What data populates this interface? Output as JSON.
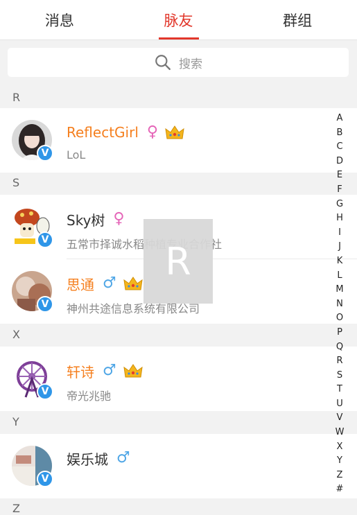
{
  "tabs": [
    {
      "label": "消息",
      "active": false
    },
    {
      "label": "脉友",
      "active": true
    },
    {
      "label": "群组",
      "active": false
    }
  ],
  "search": {
    "placeholder": "搜索"
  },
  "sections": [
    "R",
    "S",
    "X",
    "Y",
    "Z"
  ],
  "contacts": [
    {
      "name": "ReflectGirl",
      "gender": "♀",
      "subtitle": "LoL",
      "vip": true,
      "verified": true
    },
    {
      "name": "Sky树",
      "gender": "♀",
      "subtitle": "五常市择诚水稻种植专业合作社",
      "vip": false,
      "verified": true
    },
    {
      "name": "思通",
      "gender": "♂",
      "subtitle": "神州共途信息系统有限公司",
      "vip": true,
      "verified": true
    },
    {
      "name": "轩诗",
      "gender": "♂",
      "subtitle": "帝光兆驰",
      "vip": true,
      "verified": true
    },
    {
      "name": "娱乐城",
      "gender": "♂",
      "subtitle": "",
      "vip": false,
      "verified": true
    }
  ],
  "index_letters": [
    "A",
    "B",
    "C",
    "D",
    "E",
    "F",
    "G",
    "H",
    "I",
    "J",
    "K",
    "L",
    "M",
    "N",
    "O",
    "P",
    "Q",
    "R",
    "S",
    "T",
    "U",
    "V",
    "W",
    "X",
    "Y",
    "Z",
    "#"
  ],
  "letter_overlay": "R",
  "verified_mark": "V",
  "colors": {
    "accent": "#e2372b",
    "vip_name": "#f57f1e",
    "female": "#e565b8",
    "male": "#4fa6e6",
    "verified": "#2f96e8"
  }
}
